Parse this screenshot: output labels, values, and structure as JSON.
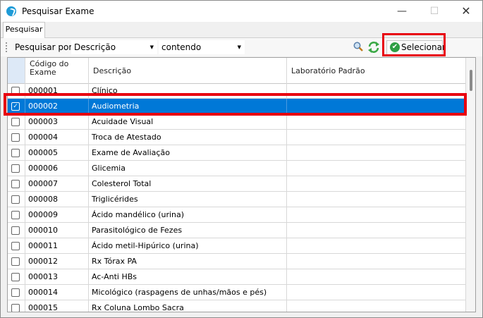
{
  "window": {
    "title": "Pesquisar Exame",
    "minimize": "—",
    "maximize": "☐",
    "close": "✕"
  },
  "tab": {
    "label": "Pesquisar"
  },
  "toolbar": {
    "search_by_label": "Pesquisar por:",
    "field_combo": "Descrição",
    "mode_combo": "contendo",
    "select_button": "Selecionar"
  },
  "grid": {
    "columns": [
      "Código do Exame",
      "Descrição",
      "Laboratório Padrão"
    ],
    "rows": [
      {
        "code": "000001",
        "desc": "Clínico",
        "lab": ""
      },
      {
        "code": "000002",
        "desc": "Audiometria",
        "lab": ""
      },
      {
        "code": "000003",
        "desc": "Acuidade Visual",
        "lab": ""
      },
      {
        "code": "000004",
        "desc": "Troca de Atestado",
        "lab": ""
      },
      {
        "code": "000005",
        "desc": "Exame de Avaliação",
        "lab": ""
      },
      {
        "code": "000006",
        "desc": "Glicemia",
        "lab": ""
      },
      {
        "code": "000007",
        "desc": "Colesterol Total",
        "lab": ""
      },
      {
        "code": "000008",
        "desc": "Triglicérides",
        "lab": ""
      },
      {
        "code": "000009",
        "desc": "Ácido mandélico (urina)",
        "lab": ""
      },
      {
        "code": "000010",
        "desc": "Parasitológico de Fezes",
        "lab": ""
      },
      {
        "code": "000011",
        "desc": "Ácido metil-Hipúrico (urina)",
        "lab": ""
      },
      {
        "code": "000012",
        "desc": "Rx Tórax PA",
        "lab": ""
      },
      {
        "code": "000013",
        "desc": "Ac-Anti HBs",
        "lab": ""
      },
      {
        "code": "000014",
        "desc": "Micológico (raspagens de unhas/mãos e pés)",
        "lab": ""
      },
      {
        "code": "000015",
        "desc": "Rx Coluna Lombo Sacra",
        "lab": ""
      }
    ],
    "selected_row": 1
  },
  "colors": {
    "selection": "#0078d7",
    "highlight_box": "#e8000f",
    "accept": "#2e9e44"
  }
}
